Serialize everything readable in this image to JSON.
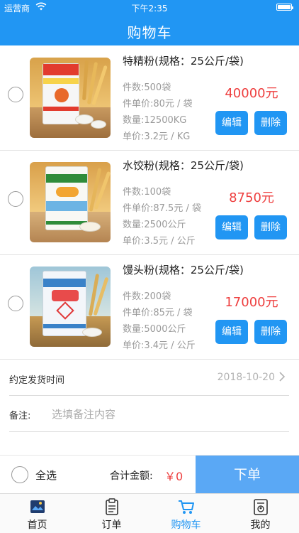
{
  "status_bar": {
    "carrier": "运营商",
    "time": "下午2:35"
  },
  "nav": {
    "title": "购物车"
  },
  "items": [
    {
      "title": "特精粉(规格：25公斤/袋)",
      "count": "件数:500袋",
      "unit_price_bag": "件单价:80元 / 袋",
      "quantity": "数量:12500KG",
      "unit_price": "单价:3.2元 / KG",
      "total": "40000元",
      "edit_label": "编辑",
      "delete_label": "删除"
    },
    {
      "title": "水饺粉(规格：25公斤/袋)",
      "count": "件数:100袋",
      "unit_price_bag": "件单价:87.5元 / 袋",
      "quantity": "数量:2500公斤",
      "unit_price": "单价:3.5元 / 公斤",
      "total": "8750元",
      "edit_label": "编辑",
      "delete_label": "删除"
    },
    {
      "title": "馒头粉(规格：25公斤/袋)",
      "count": "件数:200袋",
      "unit_price_bag": "件单价:85元 / 袋",
      "quantity": "数量:5000公斤",
      "unit_price": "单价:3.4元 / 公斤",
      "total": "17000元",
      "edit_label": "编辑",
      "delete_label": "删除"
    }
  ],
  "delivery": {
    "label": "约定发货时间",
    "value": "2018-10-20"
  },
  "remark": {
    "label": "备注:",
    "placeholder": "选填备注内容"
  },
  "footer": {
    "select_all": "全选",
    "total_label": "合计金额:",
    "total_value": "￥0",
    "order_button": "下单"
  },
  "tabs": [
    {
      "label": "首页",
      "icon": "home-icon",
      "active": false
    },
    {
      "label": "订单",
      "icon": "clipboard-icon",
      "active": false
    },
    {
      "label": "购物车",
      "icon": "cart-icon",
      "active": true
    },
    {
      "label": "我的",
      "icon": "profile-icon",
      "active": false
    }
  ],
  "colors": {
    "primary": "#2196f3",
    "price": "#ee3f3f",
    "order_button": "#5aa8f5"
  }
}
